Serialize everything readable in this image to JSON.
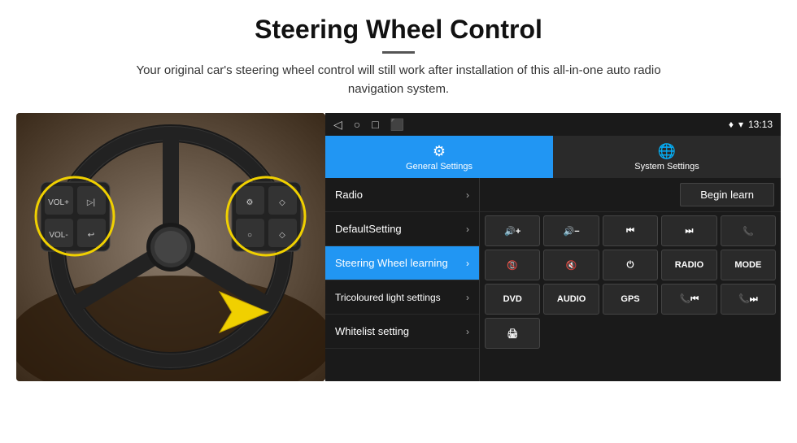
{
  "header": {
    "title": "Steering Wheel Control",
    "divider": true,
    "description": "Your original car's steering wheel control will still work after installation of this all-in-one auto radio navigation system."
  },
  "statusBar": {
    "navIcons": [
      "◁",
      "○",
      "□",
      "⬛"
    ],
    "rightIcons": "♦ ▾",
    "time": "13:13"
  },
  "tabs": [
    {
      "id": "general",
      "label": "General Settings",
      "icon": "⚙",
      "active": true
    },
    {
      "id": "system",
      "label": "System Settings",
      "icon": "🌐",
      "active": false
    }
  ],
  "menuItems": [
    {
      "id": "radio",
      "label": "Radio",
      "active": false
    },
    {
      "id": "default",
      "label": "DefaultSetting",
      "active": false
    },
    {
      "id": "steering",
      "label": "Steering Wheel learning",
      "active": true
    },
    {
      "id": "tricoloured",
      "label": "Tricoloured light settings",
      "active": false
    },
    {
      "id": "whitelist",
      "label": "Whitelist setting",
      "active": false
    }
  ],
  "beginLearnBtn": "Begin learn",
  "controlButtons": {
    "row1": [
      {
        "id": "vol-up",
        "label": "🔊+",
        "text": ""
      },
      {
        "id": "vol-down",
        "label": "🔊-",
        "text": ""
      },
      {
        "id": "prev-track",
        "label": "⏮",
        "text": ""
      },
      {
        "id": "next-track",
        "label": "⏭",
        "text": ""
      },
      {
        "id": "phone",
        "label": "📞",
        "text": ""
      }
    ],
    "row2": [
      {
        "id": "hang-up",
        "label": "📵",
        "text": ""
      },
      {
        "id": "mute",
        "label": "🔇",
        "text": ""
      },
      {
        "id": "power",
        "label": "⏻",
        "text": ""
      },
      {
        "id": "radio-btn",
        "label": "RADIO",
        "text": "RADIO"
      },
      {
        "id": "mode",
        "label": "MODE",
        "text": "MODE"
      }
    ],
    "row3": [
      {
        "id": "dvd",
        "label": "DVD",
        "text": "DVD"
      },
      {
        "id": "audio",
        "label": "AUDIO",
        "text": "AUDIO"
      },
      {
        "id": "gps",
        "label": "GPS",
        "text": "GPS"
      },
      {
        "id": "tel-prev",
        "label": "📞⏮",
        "text": ""
      },
      {
        "id": "tel-next",
        "label": "📞⏭",
        "text": ""
      }
    ],
    "row4": [
      {
        "id": "extra",
        "label": "🖨",
        "text": ""
      }
    ]
  }
}
